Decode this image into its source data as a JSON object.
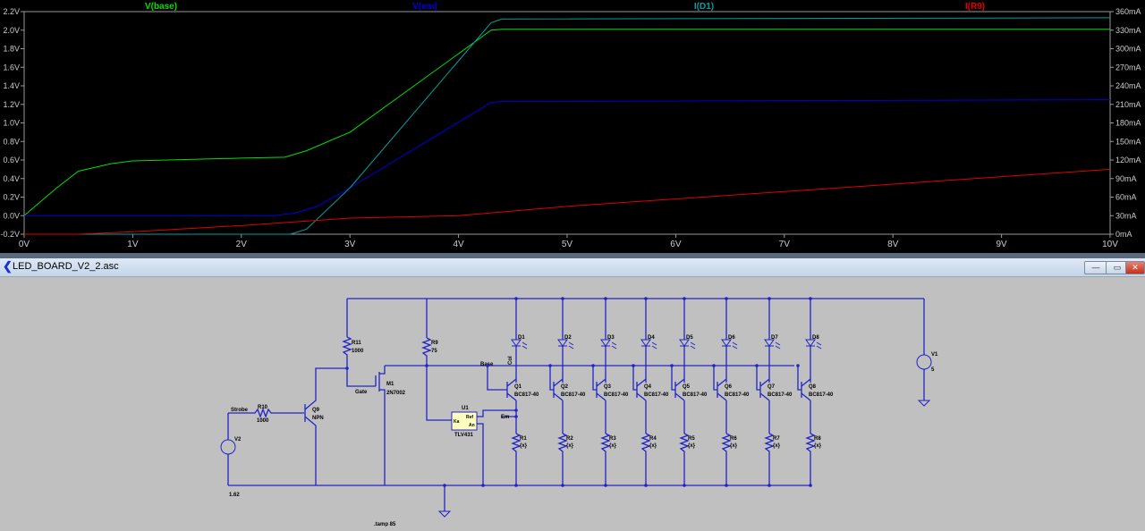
{
  "chart_data": {
    "type": "line",
    "x_ticks": [
      "0V",
      "1V",
      "2V",
      "3V",
      "4V",
      "5V",
      "6V",
      "7V",
      "8V",
      "9V",
      "10V"
    ],
    "xlim": [
      0,
      10
    ],
    "y_left_ticks": [
      "-0.2V",
      "0.0V",
      "0.2V",
      "0.4V",
      "0.6V",
      "0.8V",
      "1.0V",
      "1.2V",
      "1.4V",
      "1.6V",
      "1.8V",
      "2.0V",
      "2.2V"
    ],
    "ylim_left": [
      -0.2,
      2.2
    ],
    "y_right_ticks": [
      "0mA",
      "30mA",
      "60mA",
      "90mA",
      "120mA",
      "150mA",
      "180mA",
      "210mA",
      "240mA",
      "270mA",
      "300mA",
      "330mA",
      "360mA"
    ],
    "ylim_right": [
      0,
      360
    ],
    "series": [
      {
        "name": "V(base)",
        "color": "#00e000",
        "axis": "left",
        "x": [
          0,
          0.3,
          0.5,
          0.8,
          1,
          2,
          2.4,
          2.6,
          3,
          4.3,
          4.4,
          10
        ],
        "y": [
          0,
          0.3,
          0.48,
          0.56,
          0.59,
          0.62,
          0.63,
          0.7,
          0.9,
          2.0,
          2.01,
          2.01
        ]
      },
      {
        "name": "V(em)",
        "color": "#0000e0",
        "axis": "left",
        "x": [
          0,
          2.3,
          2.5,
          2.7,
          3,
          4.3,
          4.4,
          10
        ],
        "y": [
          0,
          0,
          0.03,
          0.1,
          0.3,
          1.22,
          1.23,
          1.25
        ]
      },
      {
        "name": "I(D1)",
        "color": "#00a0a0",
        "axis": "right",
        "x": [
          0,
          2.45,
          2.6,
          3,
          4.3,
          4.4,
          10
        ],
        "y": [
          0,
          0,
          8,
          75,
          342,
          348,
          350
        ]
      },
      {
        "name": "I(R9)",
        "color": "#e00000",
        "axis": "right",
        "x": [
          0,
          0.5,
          1,
          2,
          2.5,
          3,
          4,
          5,
          10
        ],
        "y": [
          0,
          0,
          4,
          14,
          20,
          26,
          30,
          45,
          105
        ]
      }
    ]
  },
  "window": {
    "title": "LED_BOARD_V2_2.asc",
    "minimize": "—",
    "maximize": "▭",
    "close": "✕"
  },
  "schematic": {
    "v2": {
      "name": "V2",
      "value": "1.62"
    },
    "v1": {
      "name": "V1",
      "value": "5"
    },
    "r10": {
      "name": "R10",
      "value": "1000"
    },
    "r11": {
      "name": "R11",
      "value": "1000"
    },
    "r9": {
      "name": "R9",
      "value": "75"
    },
    "q9": {
      "name": "Q9",
      "value": "NPN"
    },
    "m1": {
      "name": "M1",
      "value": "2N7002"
    },
    "u1": {
      "name": "U1",
      "value": "TLV431",
      "pin_ka": "Ka",
      "pin_ref": "Ref",
      "pin_an": "An"
    },
    "nets": {
      "strobe": "Strobe",
      "gate": "Gate",
      "base": "Base",
      "em": "Em",
      "col": "Col"
    },
    "directive": ".tamp 85",
    "channels": [
      {
        "d": "D1",
        "q": "Q1",
        "r": "R1",
        "qv": "BC817-40",
        "rv": "{x}"
      },
      {
        "d": "D2",
        "q": "Q2",
        "r": "R2",
        "qv": "BC817-40",
        "rv": "{x}"
      },
      {
        "d": "D3",
        "q": "Q3",
        "r": "R3",
        "qv": "BC817-40",
        "rv": "{x}"
      },
      {
        "d": "D4",
        "q": "Q4",
        "r": "R4",
        "qv": "BC817-40",
        "rv": "{x}"
      },
      {
        "d": "D5",
        "q": "Q5",
        "r": "R5",
        "qv": "BC817-40",
        "rv": "{x}"
      },
      {
        "d": "D6",
        "q": "Q6",
        "r": "R6",
        "qv": "BC817-40",
        "rv": "{x}"
      },
      {
        "d": "D7",
        "q": "Q7",
        "r": "R7",
        "qv": "BC817-40",
        "rv": "{x}"
      },
      {
        "d": "D8",
        "q": "Q8",
        "r": "R8",
        "qv": "BC817-40",
        "rv": "{x}"
      }
    ]
  }
}
